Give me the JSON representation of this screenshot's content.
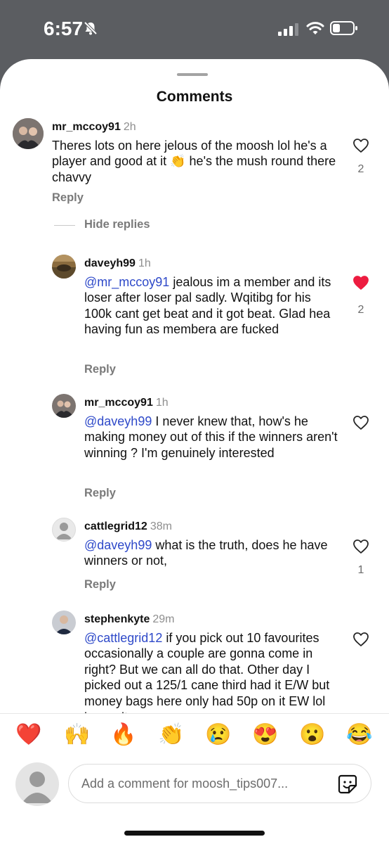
{
  "status_bar": {
    "time": "6:57"
  },
  "sheet": {
    "title": "Comments"
  },
  "comments": [
    {
      "username": "mr_mccoy91",
      "time": "2h",
      "text_before": "Theres lots on here jelous of the moosh lol he's a player and good at it ",
      "emoji": "👏",
      "text_after": "  he's the mush round there chavvy",
      "reply_label": "Reply",
      "likes": "2",
      "liked": false
    },
    {
      "username": "daveyh99",
      "time": "1h",
      "mention": "@mr_mccoy91",
      "text": " jealous im a member and its loser after loser pal sadly. Wqitibg for his 100k cant get beat and it got beat. Glad hea having fun as membera are fucked",
      "reply_label": "Reply",
      "likes": "2",
      "liked": true
    },
    {
      "username": "mr_mccoy91",
      "time": "1h",
      "mention": "@daveyh99",
      "text": " I never knew that, how's he making money out of this if the winners aren't winning ? I'm genuinely interested",
      "reply_label": "Reply",
      "likes": "",
      "liked": false
    },
    {
      "username": "cattlegrid12",
      "time": "38m",
      "mention": "@daveyh99",
      "text": " what is the truth, does he have winners or not,",
      "reply_label": "Reply",
      "likes": "1",
      "liked": false
    },
    {
      "username": "stephenkyte",
      "time": "29m",
      "mention": "@cattlegrid12",
      "text": " if you pick out 10 favourites occasionally a couple are gonna come in right? But we can all do that. Other day I picked out a 125/1 cane third had it E/W but money bags here only had 50p on it EW lol keeps it",
      "reply_label": "Reply",
      "likes": "",
      "liked": false
    }
  ],
  "hide_replies_label": "Hide replies",
  "reactions": [
    "❤️",
    "🙌",
    "🔥",
    "👏",
    "😢",
    "😍",
    "😮",
    "😂"
  ],
  "compose": {
    "placeholder": "Add a comment for moosh_tips007..."
  },
  "colors": {
    "mention": "#2e49c9",
    "like_active": "#ed1c40",
    "status_bg": "#5b5d61"
  },
  "icons": [
    "mute-bell-icon",
    "cellular-signal-icon",
    "wifi-icon",
    "battery-icon",
    "heart-icon",
    "sticker-icon",
    "default-avatar-icon"
  ]
}
